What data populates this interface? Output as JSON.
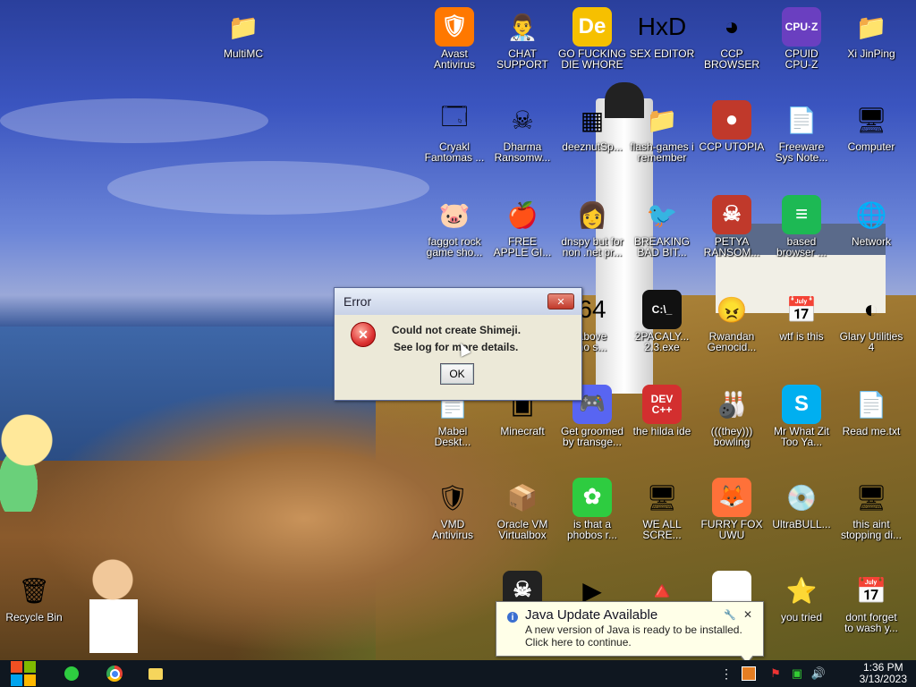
{
  "desktop": {
    "icons": [
      {
        "label": "MultiMC",
        "icon": "folder-icon",
        "glyph": "📁",
        "name": "multimc"
      },
      {
        "label": "Avast\nAntivirus",
        "icon": "avast-icon",
        "glyph": "🛡",
        "name": "avast-antivirus"
      },
      {
        "label": "CHAT\nSUPPORT",
        "icon": "doctor-icon",
        "glyph": "👨‍⚕️",
        "name": "chat-support"
      },
      {
        "label": "GO FUCKING\nDIE WHORE",
        "icon": "de-icon",
        "glyph": "De",
        "name": "go-fucking-die-whore"
      },
      {
        "label": "SEX EDITOR",
        "icon": "hxd-icon",
        "glyph": "HxD",
        "name": "sex-editor"
      },
      {
        "label": "CCP\nBROWSER",
        "icon": "chromium-icon",
        "glyph": "◕",
        "name": "ccp-browser"
      },
      {
        "label": "CPUID\nCPU-Z",
        "icon": "cpuz-icon",
        "glyph": "CPU·Z",
        "name": "cpuid-cpu-z"
      },
      {
        "label": "Xi JinPing",
        "icon": "user-folder-icon",
        "glyph": "📁",
        "name": "xi-jinping"
      },
      {
        "label": "Cryakl\nFantomas ...",
        "icon": "window-icon",
        "glyph": "🗔",
        "name": "cryakl"
      },
      {
        "label": "Dharma\nRansomw...",
        "icon": "skull-icon",
        "glyph": "☠",
        "name": "dharma"
      },
      {
        "label": "deeznutSp...",
        "icon": "stack-icon",
        "glyph": "▦",
        "name": "deeznut"
      },
      {
        "label": "flash-games i\nremember",
        "icon": "folder-icon",
        "glyph": "📁",
        "name": "flash-games"
      },
      {
        "label": "CCP UTOPIA",
        "icon": "red-circle-icon",
        "glyph": "●",
        "name": "ccp-utopia"
      },
      {
        "label": "Freeware\nSys Note...",
        "icon": "document-icon",
        "glyph": "📄",
        "name": "freeware-sys-note"
      },
      {
        "label": "Computer",
        "icon": "computer-icon",
        "glyph": "🖥",
        "name": "computer"
      },
      {
        "label": "faggot rock\ngame sho...",
        "icon": "pig-icon",
        "glyph": "🐷",
        "name": "rock-game"
      },
      {
        "label": "FREE\nAPPLE GI...",
        "icon": "apple-icon",
        "glyph": "🍎",
        "name": "free-apple"
      },
      {
        "label": "dnspy but for\nnon .net pr...",
        "icon": "portrait-icon",
        "glyph": "👩",
        "name": "dnspy"
      },
      {
        "label": "BREAKING\nBAD BIT...",
        "icon": "angry-bird-icon",
        "glyph": "🐦",
        "name": "breaking-bad"
      },
      {
        "label": "PETYA\nRANSOM...",
        "icon": "petya-skull-icon",
        "glyph": "☠",
        "name": "petya"
      },
      {
        "label": "based\nbrowser ...",
        "icon": "green-chat-icon",
        "glyph": "≡",
        "name": "based-browser"
      },
      {
        "label": "Network",
        "icon": "network-icon",
        "glyph": "🌐",
        "name": "network"
      },
      {
        "label": "above\nno s...",
        "icon": "red-64-icon",
        "glyph": "64",
        "name": "above-no-s"
      },
      {
        "label": "2PACALY...\n2.3.exe",
        "icon": "terminal-icon",
        "glyph": "C:\\_",
        "name": "2pacaly"
      },
      {
        "label": "Rwandan\nGenocid...",
        "icon": "meme-icon",
        "glyph": "😠",
        "name": "rwandan"
      },
      {
        "label": "wtf is this",
        "icon": "calendar-doc-icon",
        "glyph": "📅",
        "name": "wtf-is-this"
      },
      {
        "label": "Glary Utilities\n4",
        "icon": "glary-icon",
        "glyph": "◐",
        "name": "glary"
      },
      {
        "label": "Mabel\nDeskt...",
        "icon": "document-icon",
        "glyph": "📄",
        "name": "mabel"
      },
      {
        "label": "Minecraft",
        "icon": "minecraft-icon",
        "glyph": "▣",
        "name": "minecraft"
      },
      {
        "label": "Get groomed\nby transge...",
        "icon": "discord-icon",
        "glyph": "🎮",
        "name": "discord"
      },
      {
        "label": "the hilda ide",
        "icon": "devcpp-icon",
        "glyph": "DEV\nC++",
        "name": "devcpp"
      },
      {
        "label": "(((they)))\nbowling",
        "icon": "bowling-icon",
        "glyph": "🎳",
        "name": "bowling"
      },
      {
        "label": "Mr What Zit\nToo Ya...",
        "icon": "skype-icon",
        "glyph": "S",
        "name": "skype"
      },
      {
        "label": "Read me.txt",
        "icon": "text-file-icon",
        "glyph": "📄",
        "name": "readme"
      },
      {
        "label": "VMD\nAntivirus",
        "icon": "shield-icon",
        "glyph": "🛡",
        "name": "vmd"
      },
      {
        "label": "Oracle VM\nVirtualbox",
        "icon": "virtualbox-icon",
        "glyph": "📦",
        "name": "virtualbox"
      },
      {
        "label": "is that a\nphobos r...",
        "icon": "icq-icon",
        "glyph": "✿",
        "name": "phobos"
      },
      {
        "label": "WE ALL\nSCRE...",
        "icon": "monitor-icon",
        "glyph": "🖥",
        "name": "we-all-scre"
      },
      {
        "label": "FURRY FOX\nUWU",
        "icon": "firefox-icon",
        "glyph": "🦊",
        "name": "firefox"
      },
      {
        "label": "UltraBULL...",
        "icon": "disc-icon",
        "glyph": "💿",
        "name": "ultrabull"
      },
      {
        "label": "this aint\nstopping di...",
        "icon": "pc-icon",
        "glyph": "🖥",
        "name": "this-aint"
      },
      {
        "label": "",
        "icon": "skull-app-icon",
        "glyph": "☠",
        "name": "skull-app"
      },
      {
        "label": "",
        "icon": "media-icon",
        "glyph": "▶",
        "name": "media"
      },
      {
        "label": "",
        "icon": "vlc-icon",
        "glyph": "🔺",
        "name": "vlc"
      },
      {
        "label": "",
        "icon": "chrome-icon",
        "glyph": "◉",
        "name": "chrome-desktop"
      },
      {
        "label": "you tried",
        "icon": "star-icon",
        "glyph": "⭐",
        "name": "you-tried"
      },
      {
        "label": "dont forget\nto wash y...",
        "icon": "calendar-doc-icon",
        "glyph": "📅",
        "name": "dont-forget"
      },
      {
        "label": "Recycle Bin",
        "icon": "recycle-bin-icon",
        "glyph": "🗑",
        "name": "recycle-bin"
      }
    ]
  },
  "error_dialog": {
    "title": "Error",
    "close": "✕",
    "line1": "Could not create Shimeji.",
    "line2": "See log for more details.",
    "ok_label": "OK"
  },
  "java_notification": {
    "title": "Java Update Available",
    "line1": "A new version of Java is ready to be installed.",
    "line2": "Click here to continue.",
    "close": "✕"
  },
  "taskbar": {
    "time": "1:36 PM",
    "date": "3/13/2023"
  },
  "colors": {
    "taskbar": "#0f1720",
    "accent": "#0078d7"
  }
}
